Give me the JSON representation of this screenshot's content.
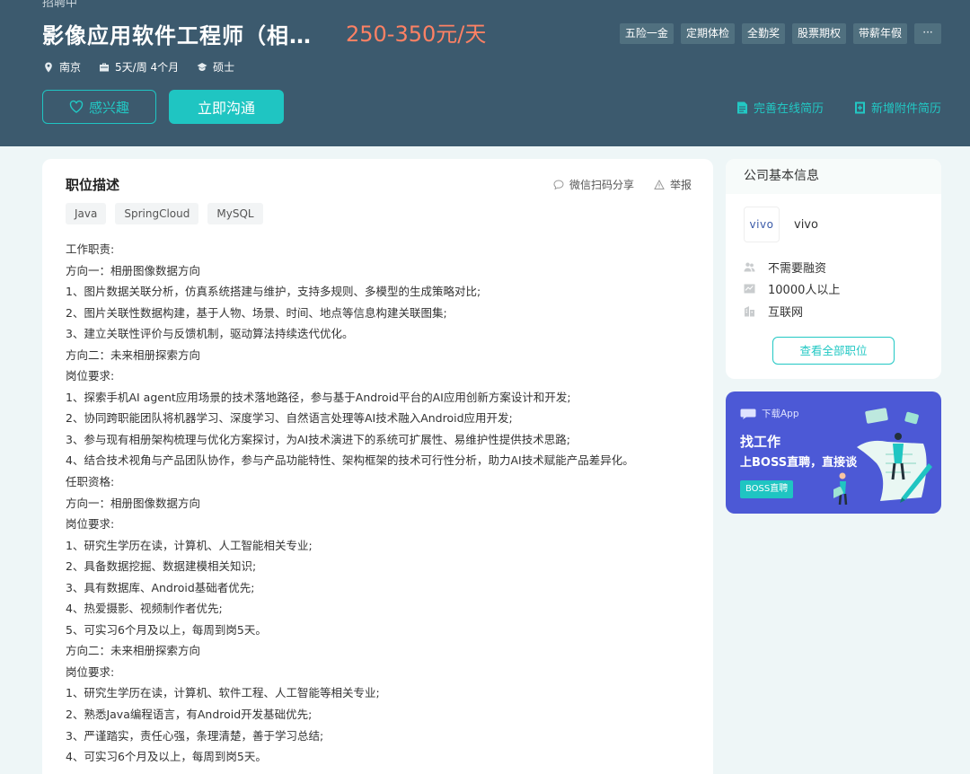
{
  "header": {
    "status_text": "招聘中",
    "job_title": "影像应用软件工程师（相…",
    "salary": "250-350元/天",
    "benefits": [
      "五险一金",
      "定期体检",
      "全勤奖",
      "股票期权",
      "带薪年假"
    ],
    "more_label": "···",
    "meta": {
      "city": "南京",
      "schedule": "5天/周 4个月",
      "degree": "硕士"
    },
    "interest_label": "感兴趣",
    "chat_label": "立即沟通",
    "complete_resume_label": "完善在线简历",
    "add_attachment_label": "新增附件简历"
  },
  "job": {
    "section_title": "职位描述",
    "share_label": "微信扫码分享",
    "report_label": "举报",
    "skill_tags": [
      "Java",
      "SpringCloud",
      "MySQL"
    ],
    "description_lines": [
      "工作职责:",
      "方向一：相册图像数据方向",
      "1、图片数据关联分析，仿真系统搭建与维护，支持多规则、多模型的生成策略对比;",
      "2、图片关联性数据构建，基于人物、场景、时间、地点等信息构建关联图集;",
      "3、建立关联性评价与反馈机制，驱动算法持续迭代优化。",
      "方向二：未来相册探索方向",
      "岗位要求:",
      "1、探索手机AI agent应用场景的技术落地路径，参与基于Android平台的AI应用创新方案设计和开发;",
      "2、协同跨职能团队将机器学习、深度学习、自然语言处理等AI技术融入Android应用开发;",
      "3、参与现有相册架构梳理与优化方案探讨，为AI技术演进下的系统可扩展性、易维护性提供技术思路;",
      "4、结合技术视角与产品团队协作，参与产品功能特性、架构框架的技术可行性分析，助力AI技术赋能产品差异化。",
      "任职资格:",
      "方向一：相册图像数据方向",
      "岗位要求:",
      "1、研究生学历在读，计算机、人工智能相关专业;",
      "2、具备数据挖掘、数据建模相关知识;",
      "3、具有数据库、Android基础者优先;",
      "4、热爱摄影、视频制作者优先;",
      "5、可实习6个月及以上，每周到岗5天。",
      "方向二：未来相册探索方向",
      "岗位要求:",
      "1、研究生学历在读，计算机、软件工程、人工智能等相关专业;",
      "2、熟悉Java编程语言，有Android开发基础优先;",
      "3、严谨踏实，责任心强，条理清楚，善于学习总结;",
      "4、可实习6个月及以上，每周到岗5天。"
    ]
  },
  "company": {
    "header": "公司基本信息",
    "logo_text": "vivo",
    "name": "vivo",
    "financing": "不需要融资",
    "size": "10000人以上",
    "industry": "互联网",
    "view_all_label": "查看全部职位"
  },
  "promo": {
    "download_label": "下载App",
    "title": "找工作",
    "subtitle": "上BOSS直聘，直接谈",
    "badge": "BOSS直聘"
  },
  "colors": {
    "banner": "#3c5a6e",
    "accent": "#1fc5c2",
    "salary": "#fe8164",
    "promo": "#4c59d6"
  }
}
